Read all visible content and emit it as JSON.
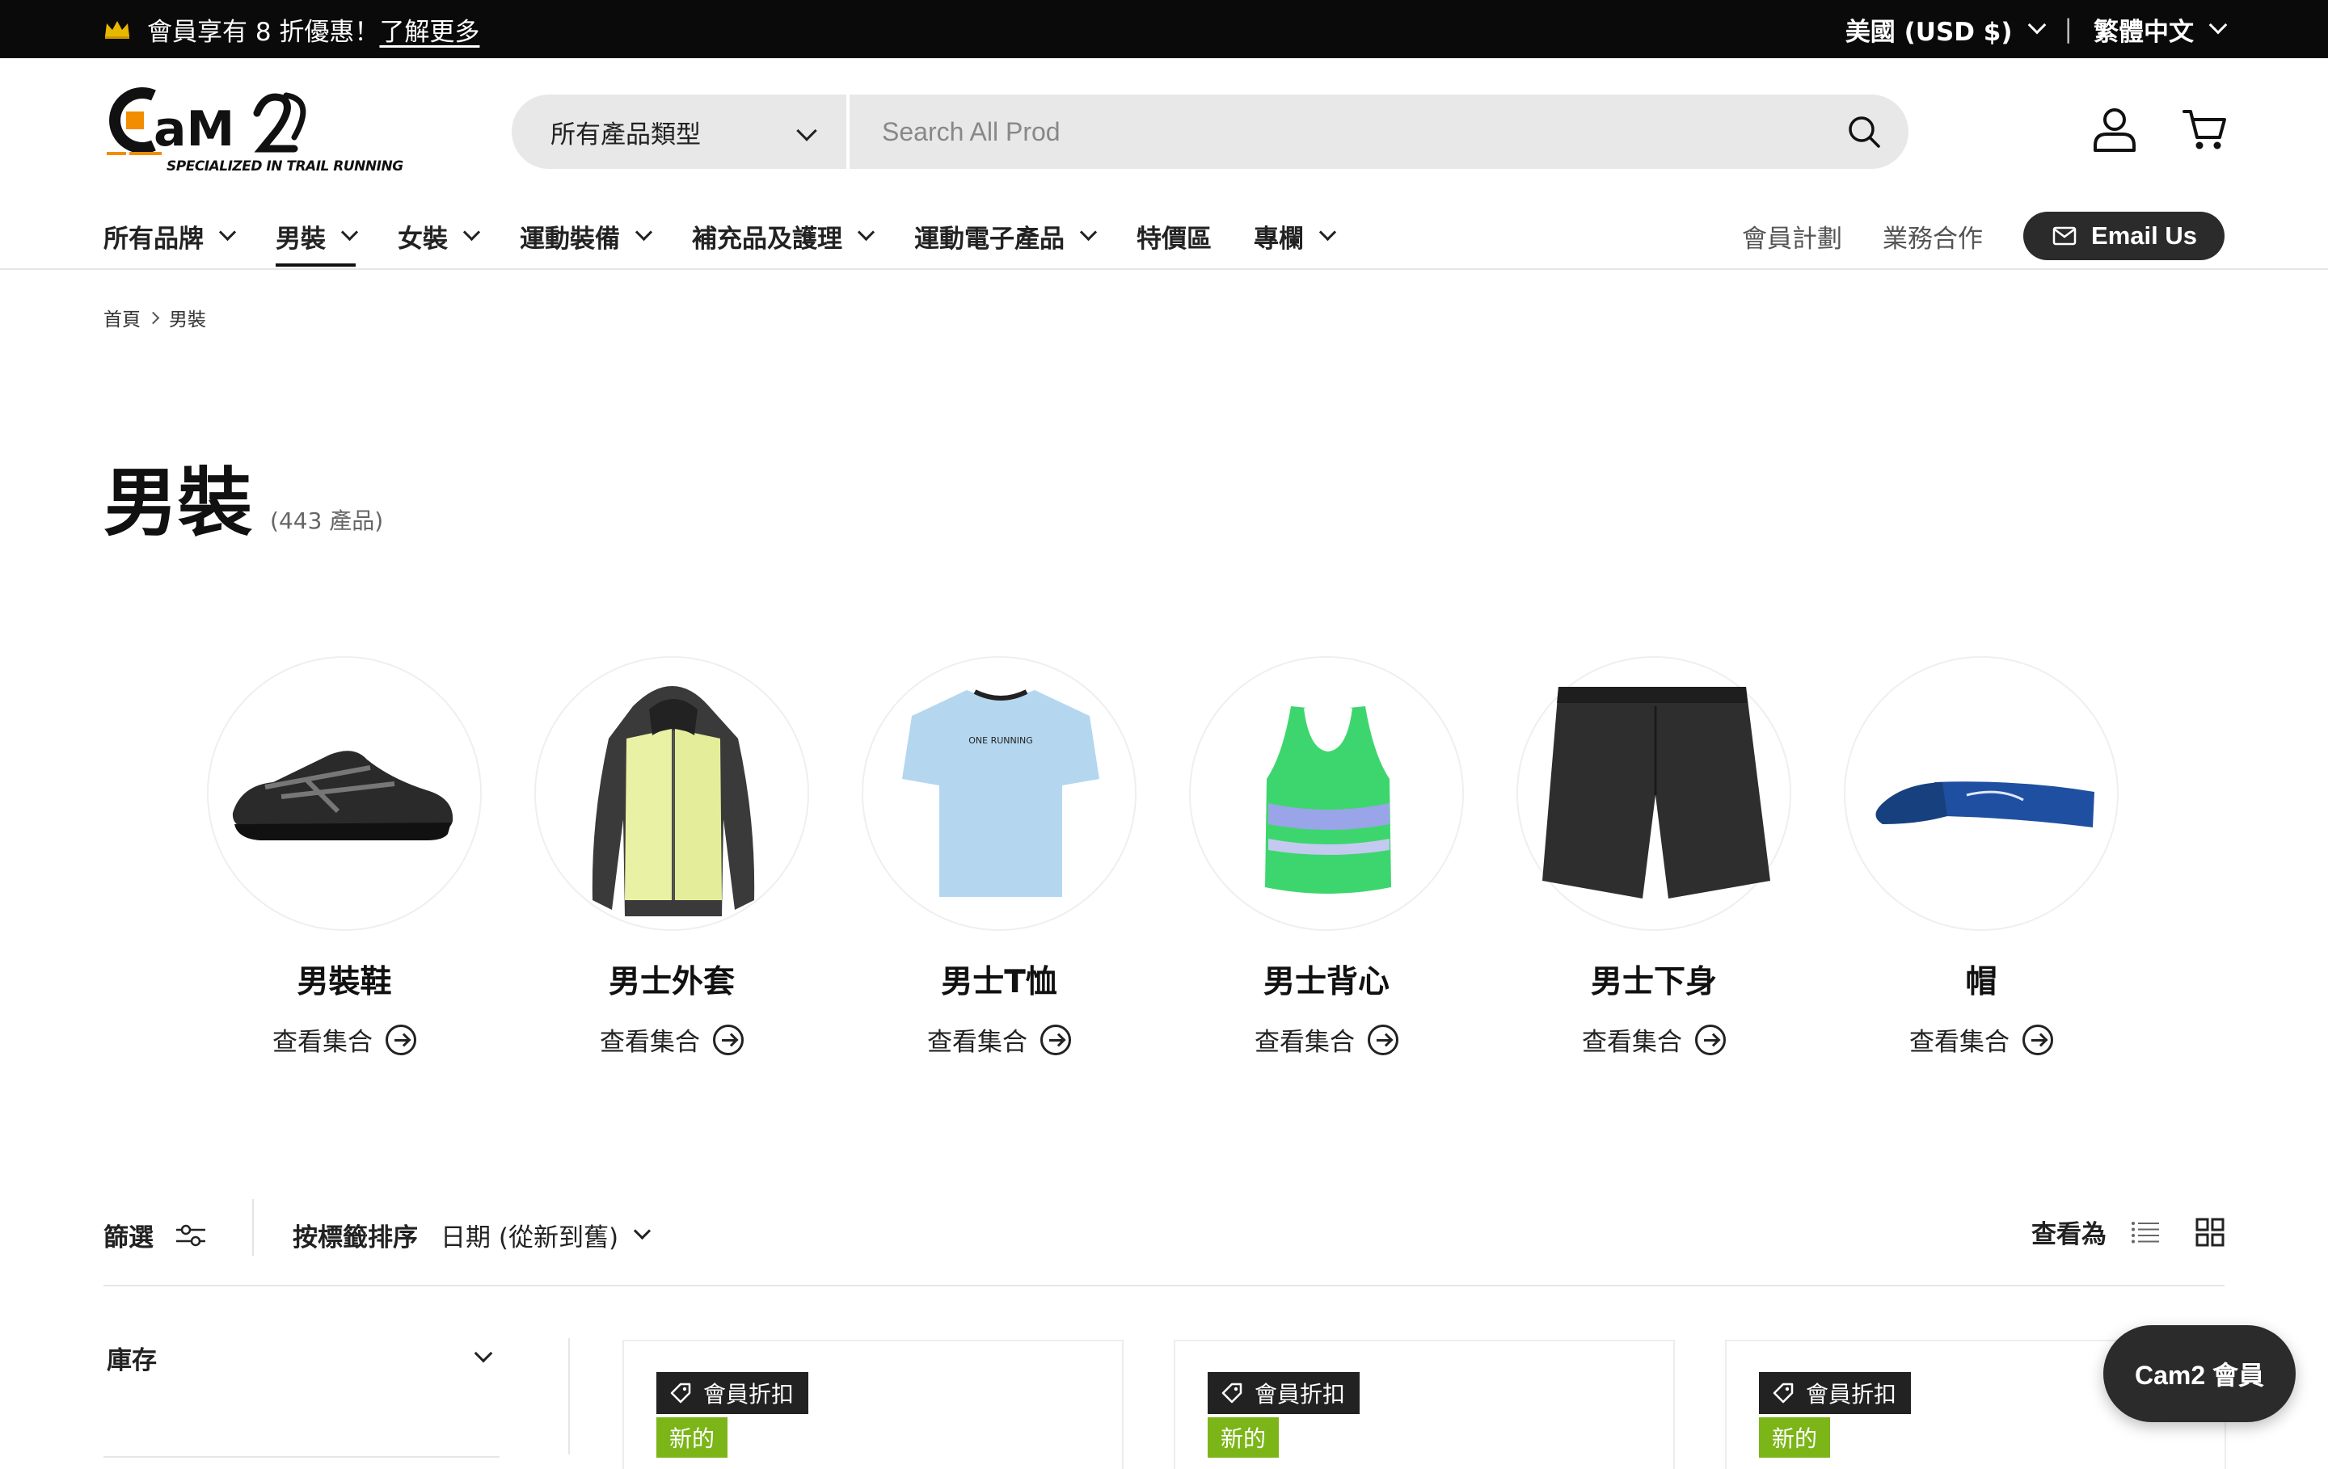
{
  "announcement": {
    "text": "會員享有 8 折優惠！",
    "link": "了解更多",
    "region": "美國 (USD $)",
    "language": "繁體中文"
  },
  "header": {
    "logo_tagline": "SPECIALIZED IN TRAIL RUNNING",
    "search_category": "所有產品類型",
    "search_placeholder": "Search All Prod"
  },
  "nav": {
    "items": [
      {
        "label": "所有品牌"
      },
      {
        "label": "男裝"
      },
      {
        "label": "女裝"
      },
      {
        "label": "運動裝備"
      },
      {
        "label": "補充品及護理"
      },
      {
        "label": "運動電子產品"
      },
      {
        "label": "特價區"
      },
      {
        "label": "專欄"
      }
    ],
    "member_plan": "會員計劃",
    "business": "業務合作",
    "email_button": "Email Us"
  },
  "breadcrumb": {
    "home": "首頁",
    "current": "男裝"
  },
  "page": {
    "title": "男裝",
    "count": "(443 產品)"
  },
  "categories": [
    {
      "name": "男裝鞋",
      "link": "查看集合"
    },
    {
      "name": "男士外套",
      "link": "查看集合"
    },
    {
      "name": "男士T恤",
      "link": "查看集合"
    },
    {
      "name": "男士背心",
      "link": "查看集合"
    },
    {
      "name": "男士下身",
      "link": "查看集合"
    },
    {
      "name": "帽",
      "link": "查看集合"
    }
  ],
  "tshirt_print": "ONE RUNNING",
  "toolbar": {
    "filter_label": "篩選",
    "sort_label": "按標籤排序",
    "sort_value": "日期 (從新到舊)",
    "view_label": "查看為"
  },
  "sidebar": {
    "stock_label": "庫存"
  },
  "products": [
    {
      "badge": "會員折扣",
      "new": "新的"
    },
    {
      "badge": "會員折扣",
      "new": "新的"
    },
    {
      "badge": "會員折扣",
      "new": "新的"
    }
  ],
  "floating": {
    "member_button": "Cam2 會員"
  },
  "colors": {
    "announce_bg": "#0a0a0a",
    "dark_button": "#2b2b2b",
    "new_badge": "#7cb518",
    "logo_accent": "#f28c00"
  }
}
